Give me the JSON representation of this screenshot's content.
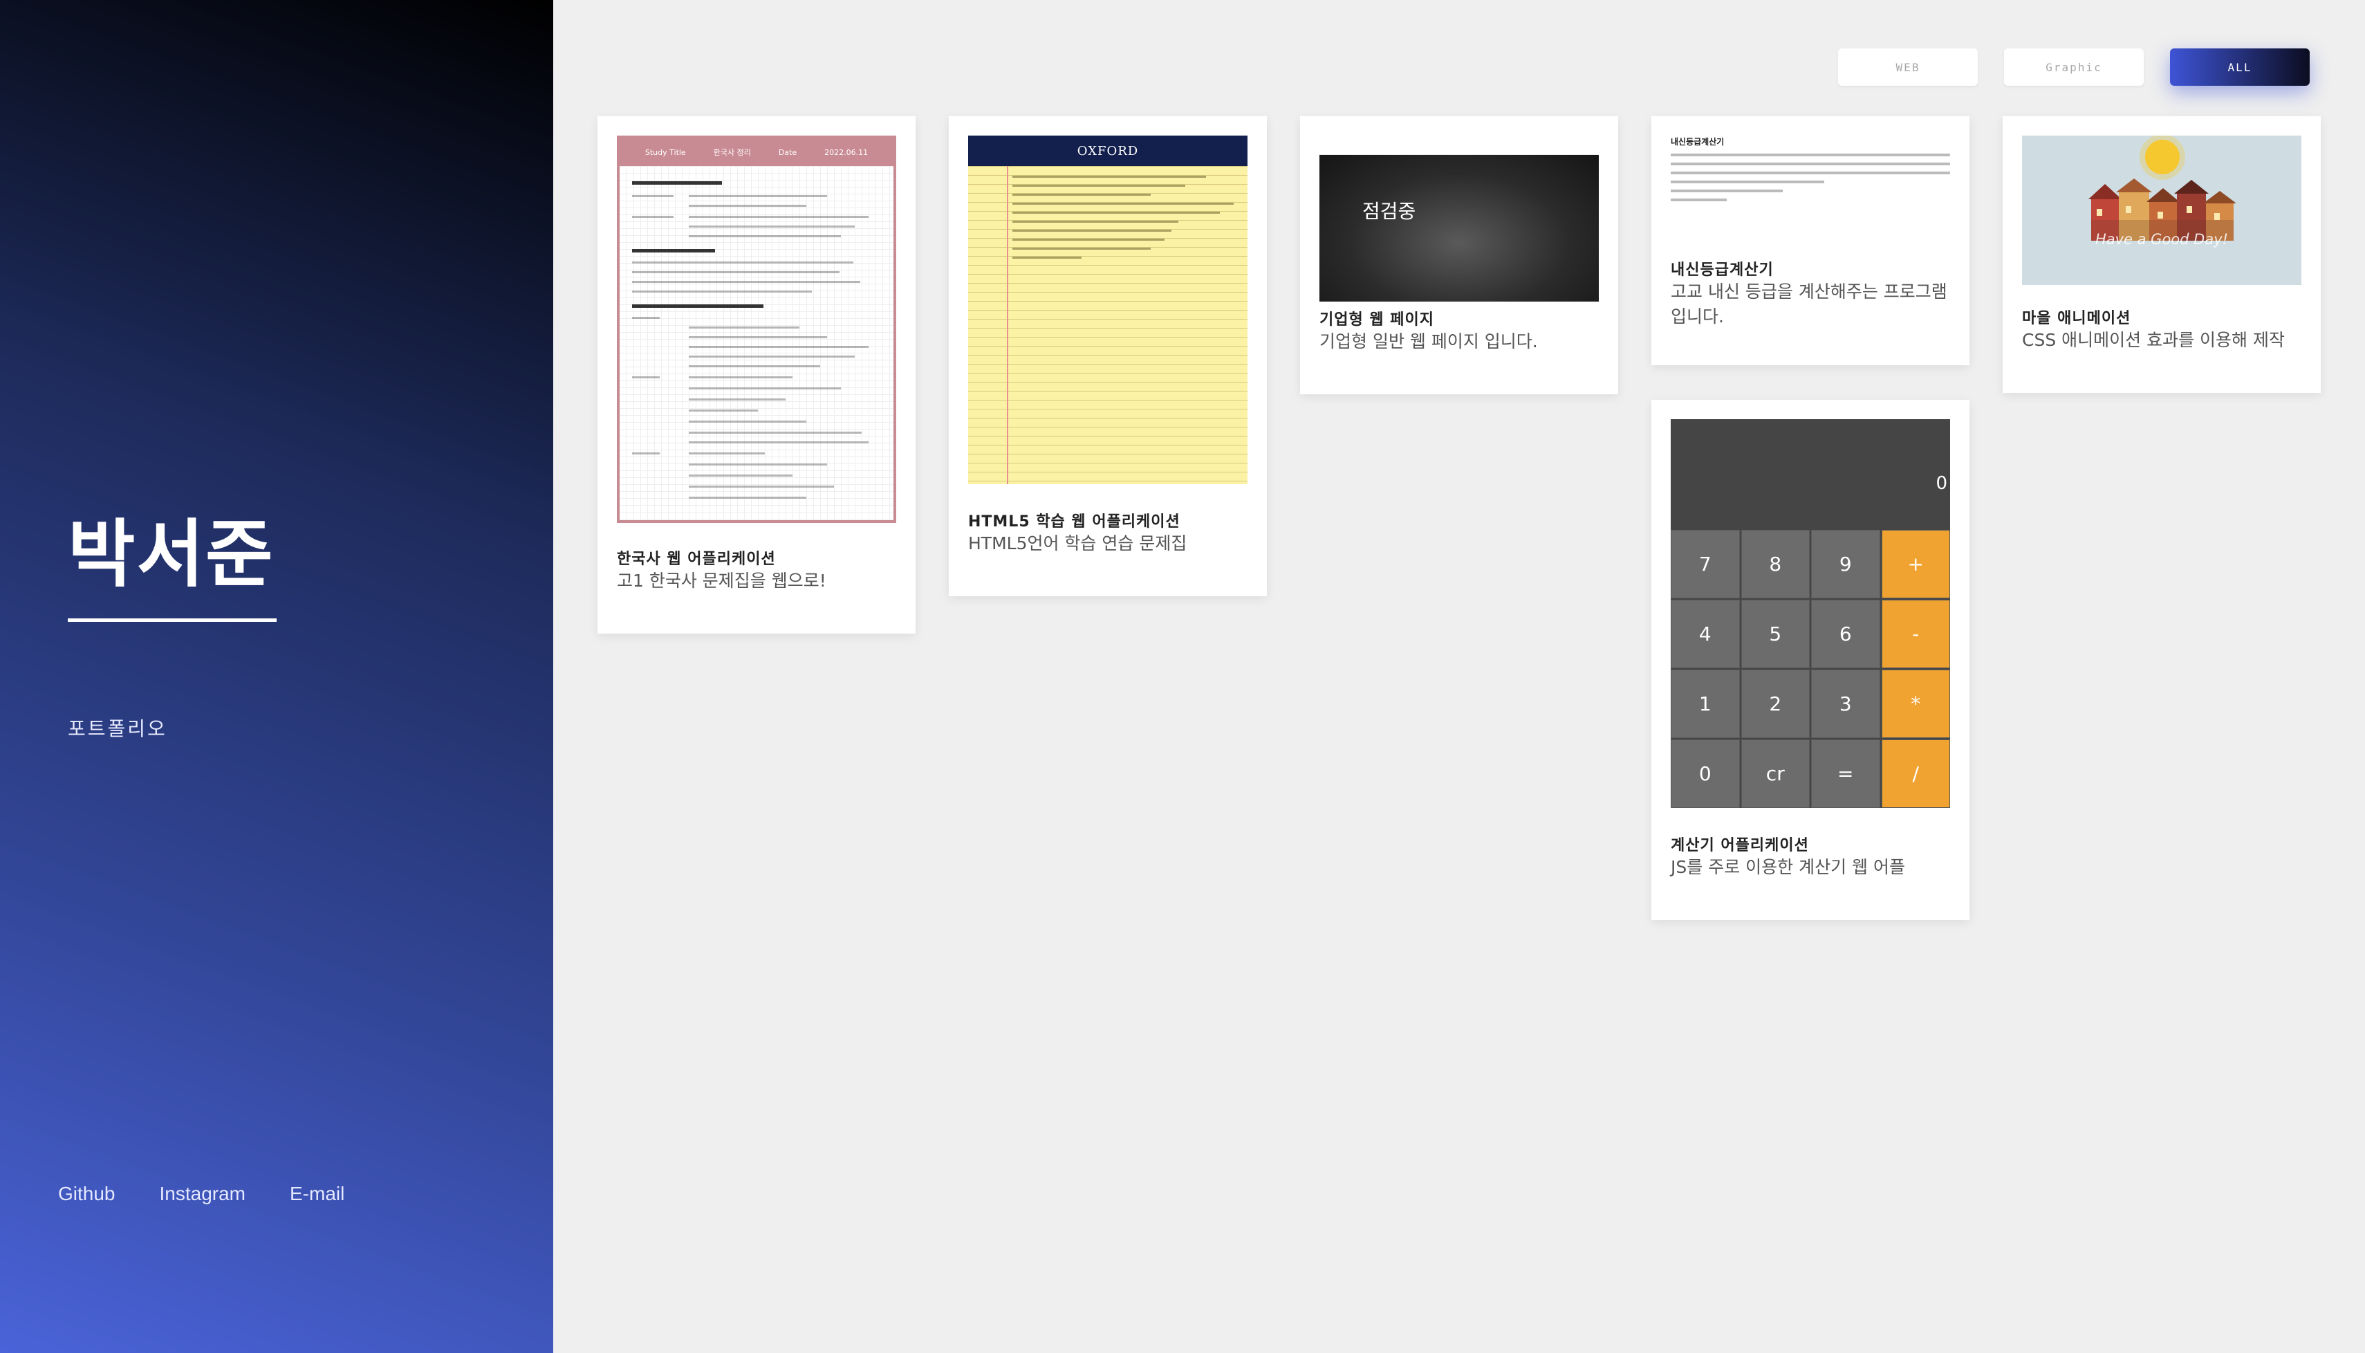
{
  "sidebar": {
    "name": "박서준",
    "subtitle": "포트폴리오",
    "links": [
      "Github",
      "Instagram",
      "E-mail"
    ]
  },
  "filters": {
    "web": "WEB",
    "graphic": "Graphic",
    "all": "ALL",
    "active": "ALL"
  },
  "cards": [
    {
      "title": "한국사 웹 어플리케이션",
      "desc": "고1 한국사 문제집을 웹으로!",
      "thumb": {
        "header_label": "Study Title",
        "header_title": "한국사 정리",
        "header_date_label": "Date",
        "header_date": "2022.06.11"
      }
    },
    {
      "title": "HTML5 학습 웹 어플리케이션",
      "desc": "HTML5언어 학습 연습 문제집",
      "thumb": {
        "brand": "OXFORD"
      }
    },
    {
      "title": "기업형 웹 페이지",
      "desc": "기업형 일반 웹 페이지 입니다.",
      "thumb": {
        "hero_text": "점검중"
      }
    },
    {
      "title": "내신등급계산기",
      "desc": "고교 내신 등급을 계산해주는 프로그램 입니다.",
      "thumb": {
        "heading": "내신등급계산기"
      }
    },
    {
      "title": "마을 애니메이션",
      "desc": "CSS 애니메이션 효과를 이용해 제작",
      "thumb": {
        "greeting": "Have a Good Day!"
      }
    },
    {
      "title": "계산기 어플리케이션",
      "desc": "JS를 주로 이용한 계산기 웹 어플",
      "calculator": {
        "display": "0",
        "keys": [
          "7",
          "8",
          "9",
          "+",
          "4",
          "5",
          "6",
          "-",
          "1",
          "2",
          "3",
          "*",
          "0",
          "cr",
          "=",
          "/"
        ],
        "op_keys": [
          "+",
          "-",
          "*",
          "/"
        ]
      }
    }
  ],
  "colors": {
    "accent": "#3e54d6",
    "operator": "#f0a330",
    "calc_body": "#454545",
    "history_frame": "#c98b93",
    "notebook": "#fbf2a6"
  }
}
